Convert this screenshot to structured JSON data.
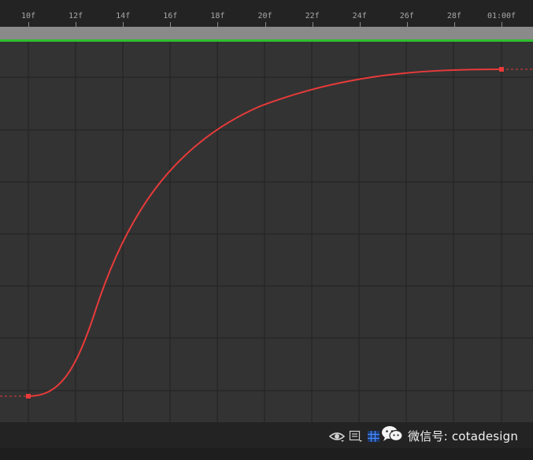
{
  "timeline": {
    "ticks": [
      "10f",
      "12f",
      "14f",
      "16f",
      "18f",
      "20f",
      "22f",
      "24f",
      "26f",
      "28f",
      "01:00f"
    ]
  },
  "graph_editor": {
    "curve_color": "#e83a3a",
    "grid_color": "#222222",
    "background_color": "#333333",
    "work_area_color": "#8a8a8a",
    "current_line_color": "#2fbf2f"
  },
  "toolbar": {
    "icons": [
      "eye-icon",
      "graph-type-icon",
      "snap-grid-icon"
    ]
  },
  "watermark": {
    "text": "微信号: cotadesign",
    "icon": "wechat-icon"
  }
}
